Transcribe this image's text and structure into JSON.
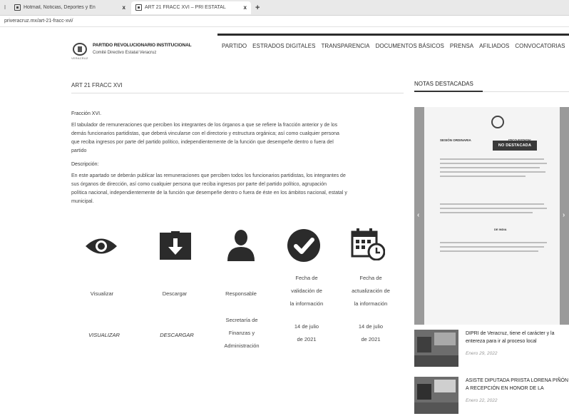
{
  "browser": {
    "lead": "I",
    "tabs": [
      {
        "title": "Hotmail, Noticias, Deportes y En",
        "close": "x"
      },
      {
        "title": "ART 21 FRACC XVI – PRI ESTATAL",
        "close": "x"
      }
    ],
    "new_tab": "+",
    "url": "priveracruz.mx/art-21-fracc-xvi/"
  },
  "site": {
    "logo_text_under": "VERACRUZ",
    "name_line1": "PARTIDO REVOLUCIONARIO INSTITUCIONAL",
    "name_line2": "Comité Directivo Estatal Veracruz",
    "nav": [
      "PARTIDO",
      "ESTRADOS DIGITALES",
      "TRANSPARENCIA",
      "DOCUMENTOS BÁSICOS",
      "PRENSA",
      "AFILIADOS",
      "CONVOCATORIAS"
    ]
  },
  "main": {
    "title": "ART 21 FRACC XVI",
    "section1_title": "Fracción XVI.",
    "section1_lines": [
      "El tabulador de remuneraciones que perciben los integrantes de los órganos a que se refiere la fracción anterior y de los",
      "demás funcionarios partidistas, que deberá vincularse con el directorio y estructura orgánica; así como cualquier persona",
      "que reciba ingresos por parte del partido político, independientemente de la función que desempeñe dentro o fuera del",
      "partido"
    ],
    "section2_title": "Descripción:",
    "section2_lines": [
      "En este apartado se deberán publicar las remuneraciones que perciben todos los funcionarios partidistas, los integrantes de",
      "sus órganos de dirección, así como cualquier persona que reciba ingresos por parte del partido político, agrupación",
      "política nacional, independientemente de la función que desempeñe dentro o fuera de éste en los ámbitos nacional, estatal y",
      "municipal."
    ],
    "table": {
      "header_col4": [
        "Fecha de",
        "validación de",
        "la información"
      ],
      "header_col5": [
        "Fecha de",
        "actualización de",
        "la información"
      ],
      "headers": [
        "Visualizar",
        "Descargar",
        "Responsable"
      ],
      "row_col1": "VISUALIZAR",
      "row_col2": "DESCARGAR",
      "row_col3": [
        "Secretaría de",
        "Finanzas y",
        "Administración"
      ],
      "row_col4": [
        "14 de julio",
        "de 2021"
      ],
      "row_col5": [
        "14 de julio",
        "de 2021"
      ]
    },
    "icons": [
      "eye-icon",
      "download-icon",
      "user-icon",
      "check-circle-icon",
      "calendar-clock-icon"
    ]
  },
  "sidebar": {
    "title": "NOTAS DESTACADAS",
    "slide_badge": "NO DESTACADA",
    "slide_doc_title_left": "SESIÓN ORDINARIA",
    "slide_doc_title_right": "ITICO ESTATAL",
    "slide_doc_title_right2": "N",
    "slide_doc_signature": "DE INDIA",
    "arrow_prev": "‹",
    "arrow_next": "›",
    "news": [
      {
        "title": "DIPRI de Veracruz, tiene el carácter y la entereza para ir al proceso local",
        "date": "Enero 29, 2022"
      },
      {
        "title": "ASISTE DIPUTADA PRIISTA LORENA PIÑÓN A RECEPCIÓN EN HONOR DE LA",
        "date": "Enero 22, 2022"
      }
    ]
  }
}
